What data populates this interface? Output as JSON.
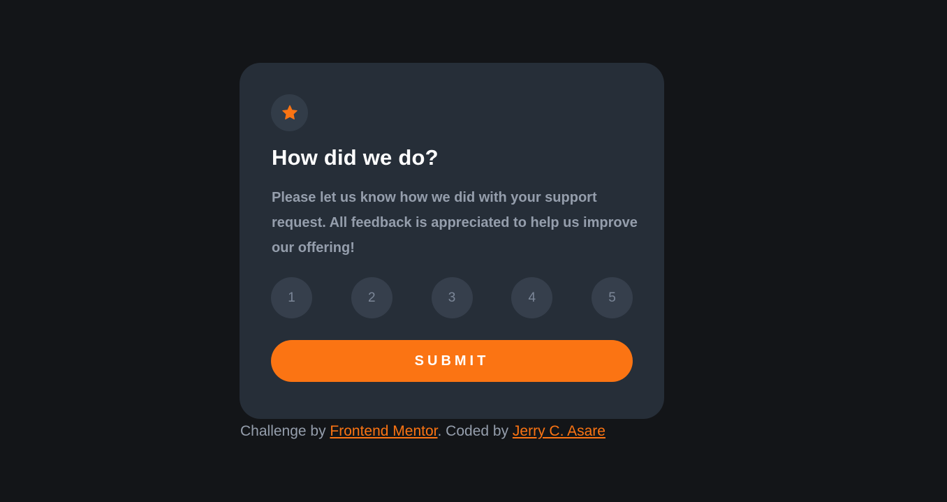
{
  "card": {
    "icon": "star-icon",
    "title": "How did we do?",
    "description": "Please let us know how we did with your support request. All feedback is appreciated to help us improve our offering!",
    "ratings": [
      "1",
      "2",
      "3",
      "4",
      "5"
    ],
    "submit_label": "SUBMIT"
  },
  "attribution": {
    "prefix": "Challenge by ",
    "link1": "Frontend Mentor",
    "middle": ". Coded by ",
    "link2": "Jerry C. Asare"
  },
  "colors": {
    "background": "#131518",
    "card": "#262e38",
    "accent": "#fb7413",
    "text_muted": "#959eac",
    "rating_bg": "#363f4c"
  }
}
